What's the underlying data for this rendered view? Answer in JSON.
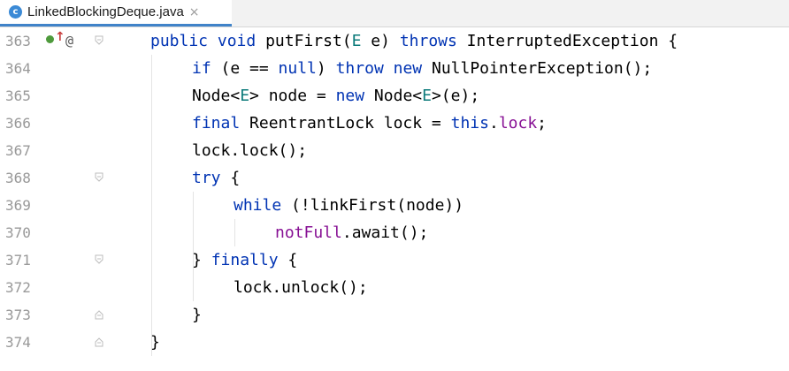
{
  "tab": {
    "title": "LinkedBlockingDeque.java",
    "icon_letter": "c",
    "close_glyph": "×"
  },
  "gutter": {
    "markers": {
      "override": "↑",
      "annotation": "@"
    }
  },
  "lines": [
    {
      "number": "363",
      "text": ""
    },
    {
      "number": "364",
      "text": ""
    },
    {
      "number": "365",
      "text": ""
    },
    {
      "number": "366",
      "text": ""
    },
    {
      "number": "367",
      "text": ""
    },
    {
      "number": "368",
      "text": ""
    },
    {
      "number": "369",
      "text": ""
    },
    {
      "number": "370",
      "text": ""
    },
    {
      "number": "371",
      "text": ""
    },
    {
      "number": "372",
      "text": ""
    },
    {
      "number": "373",
      "text": ""
    },
    {
      "number": "374",
      "text": ""
    }
  ],
  "code": {
    "l363": [
      "public",
      " ",
      "void",
      " putFirst(",
      "E",
      " e) ",
      "throws",
      " InterruptedException {"
    ],
    "l364": [
      "if",
      " (e == ",
      "null",
      ") ",
      "throw",
      " ",
      "new",
      " NullPointerException();"
    ],
    "l365": [
      "Node<",
      "E",
      "> node = ",
      "new",
      " Node<",
      "E",
      ">(e);"
    ],
    "l366": [
      "final",
      " ReentrantLock lock = ",
      "this",
      ".",
      "lock",
      ";"
    ],
    "l367": [
      "lock.lock();"
    ],
    "l368": [
      "try",
      " {"
    ],
    "l369": [
      "while",
      " (!linkFirst(node))"
    ],
    "l370": [
      "notFull",
      ".await();"
    ],
    "l371": [
      "} ",
      "finally",
      " {"
    ],
    "l372": [
      "lock.unlock();"
    ],
    "l373": [
      "}"
    ],
    "l374": [
      "}"
    ]
  },
  "colors": {
    "keyword": "#0033b3",
    "type_param": "#0b7a7a",
    "field": "#871094",
    "line_number": "#999999",
    "tab_underline": "#4083c9"
  }
}
